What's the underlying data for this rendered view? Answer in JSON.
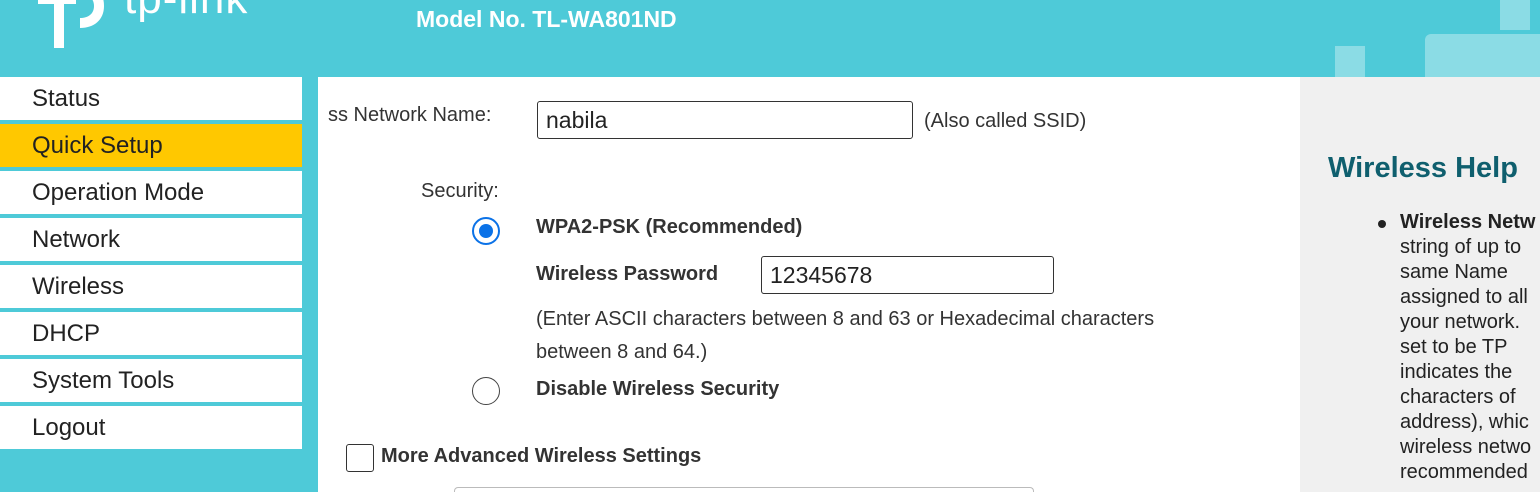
{
  "header": {
    "logo_text": "tp-link",
    "model": "Model No. TL-WA801ND"
  },
  "sidebar": {
    "items": [
      {
        "label": "Status",
        "active": false
      },
      {
        "label": "Quick Setup",
        "active": true
      },
      {
        "label": "Operation Mode",
        "active": false
      },
      {
        "label": "Network",
        "active": false
      },
      {
        "label": "Wireless",
        "active": false
      },
      {
        "label": "DHCP",
        "active": false
      },
      {
        "label": "System Tools",
        "active": false
      },
      {
        "label": "Logout",
        "active": false
      }
    ]
  },
  "form": {
    "network_name_label": "ss Network Name:",
    "network_name_value": "nabila",
    "network_name_note": "(Also called SSID)",
    "security_label": "Security:",
    "wpa2_label": "WPA2-PSK (Recommended)",
    "wpa2_selected": true,
    "password_label": "Wireless Password",
    "password_value": "12345678",
    "hint_line1": "(Enter ASCII characters between 8 and 63 or Hexadecimal characters",
    "hint_line2": "between 8 and 64.)",
    "disable_label": "Disable Wireless Security",
    "disable_selected": false,
    "advanced_label": "More Advanced Wireless Settings",
    "advanced_checked": false
  },
  "help": {
    "title": "Wireless Help",
    "lines": [
      "Wireless Netw",
      "string of up to",
      "same  Name",
      "assigned to all",
      "your network.",
      "set  to  be  TP",
      "indicates  the",
      "characters  of",
      "address), whic",
      "wireless netwo",
      "recommended"
    ]
  },
  "colors": {
    "brand": "#4ecad8",
    "active_nav": "#ffc800",
    "radio_selected": "#0b72e7",
    "help_title": "#0f5f6e"
  }
}
